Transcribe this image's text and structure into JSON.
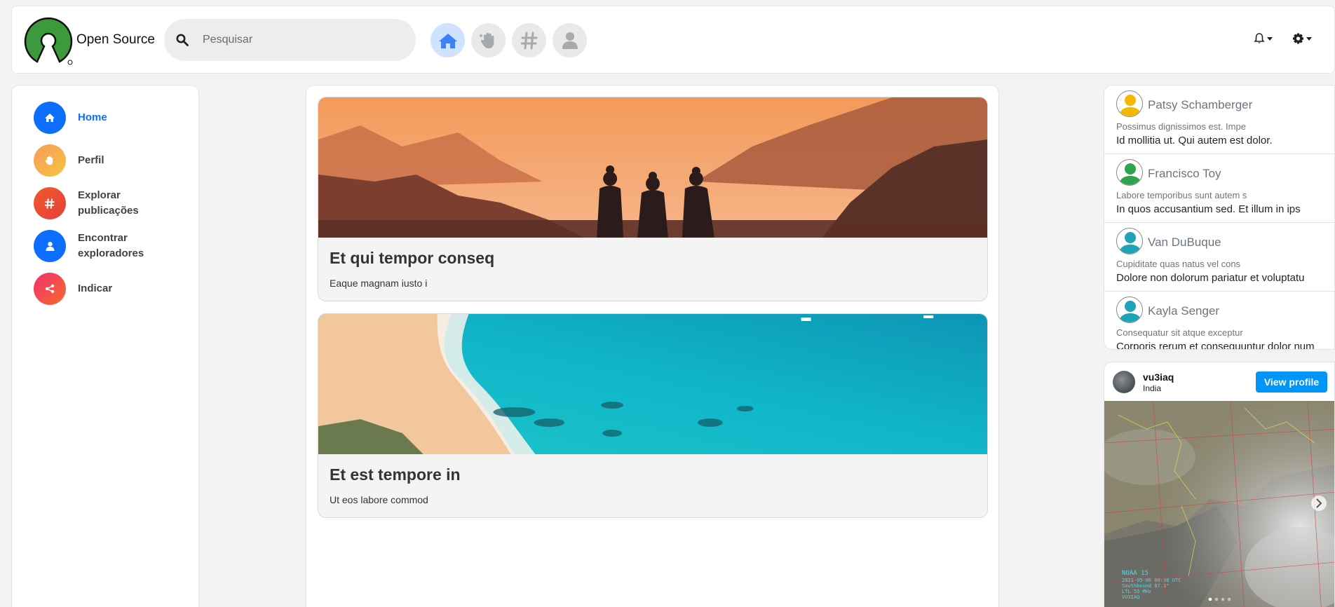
{
  "header": {
    "brand": "Open Source",
    "search_placeholder": "Pesquisar",
    "nav": [
      {
        "icon": "home-icon",
        "active": true
      },
      {
        "icon": "hand-icon",
        "active": false
      },
      {
        "icon": "hashtag-icon",
        "active": false
      },
      {
        "icon": "user-icon",
        "active": false
      }
    ],
    "right_icons": [
      "bell-icon",
      "gear-icon"
    ]
  },
  "sidebar": {
    "items": [
      {
        "label": "Home",
        "icon": "home-icon",
        "color": "#0d6efd",
        "active": true
      },
      {
        "label": "Perfil",
        "icon": "hand-icon",
        "color": "#f4a640"
      },
      {
        "label": "Explorar publicações",
        "icon": "hashtag-icon",
        "color": "#f0522b"
      },
      {
        "label": "Encontrar exploradores",
        "icon": "user-icon",
        "color": "#0d6efd"
      },
      {
        "label": "Indicar",
        "icon": "share-icon",
        "color": "#f0306e"
      }
    ]
  },
  "feed": {
    "posts": [
      {
        "title": "Et qui tempor conseq",
        "text": "Eaque magnam iusto i"
      },
      {
        "title": "Et est tempore in",
        "text": "Ut eos labore commod"
      }
    ]
  },
  "people": [
    {
      "name": "Patsy Schamberger",
      "sub": "Possimus dignissimos est. Impe",
      "msg": "Id mollitia ut. Qui autem est dolor.",
      "color": "#f5b800"
    },
    {
      "name": "Francisco Toy",
      "sub": "Labore temporibus sunt autem s",
      "msg": "In quos accusantium sed. Et illum in ips",
      "color": "#2ea44f"
    },
    {
      "name": "Van DuBuque",
      "sub": "Cupiditate quas natus vel cons",
      "msg": "Dolore non dolorum pariatur et voluptatu",
      "color": "#1fa3b8"
    },
    {
      "name": "Kayla Senger",
      "sub": "Consequatur sit atque exceptur",
      "msg": "Corporis rerum et consequuntur dolor num",
      "color": "#1fa3b8"
    }
  ],
  "embed": {
    "username": "vu3iaq",
    "location": "India",
    "button": "View profile",
    "overlay_lines": [
      "NOAA 15",
      "2021-05-06 00:30 UTC",
      "Southbound 87.1°",
      "LTL 55 MHz",
      "VU3IAQ"
    ]
  }
}
